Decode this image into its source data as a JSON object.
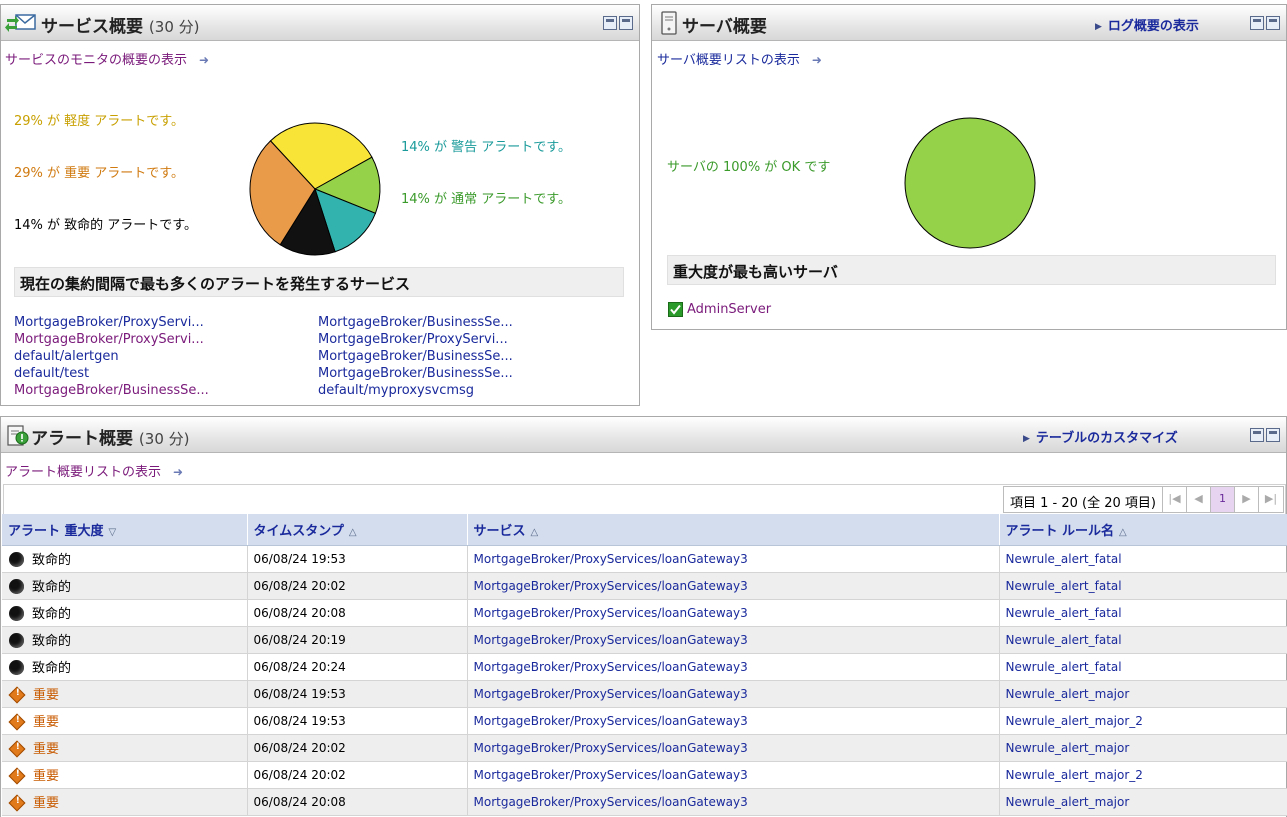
{
  "service_panel": {
    "title": "サービス概要",
    "period": "(30 分)",
    "monitor_link": "サービスのモニタの概要の表示",
    "arrow": "➜",
    "pie_labels": {
      "minor": "29% が 軽度 アラートです。",
      "major": "29% が 重要 アラートです。",
      "fatal": "14% が 致命的 アラートです。",
      "warning": "14% が 警告 アラートです。",
      "normal": "14% が 通常 アラートです。"
    },
    "top_section_title": "現在の集約間隔で最も多くのアラートを発生するサービス",
    "services_col1": [
      "MortgageBroker/ProxyServi...",
      "MortgageBroker/ProxyServi...",
      "default/alertgen",
      "default/test",
      "MortgageBroker/BusinessSe..."
    ],
    "services_col2": [
      "MortgageBroker/BusinessSe...",
      "MortgageBroker/ProxyServi...",
      "MortgageBroker/BusinessSe...",
      "MortgageBroker/BusinessSe...",
      "default/myproxysvcmsg"
    ]
  },
  "chart_data": {
    "type": "pie",
    "labels": [
      "軽度",
      "通常",
      "警告",
      "致命的",
      "重要"
    ],
    "values": [
      29,
      14,
      14,
      14,
      29
    ],
    "colors": [
      "#f7e436",
      "#96d14a",
      "#33b3ad",
      "#111111",
      "#e99b4a"
    ]
  },
  "server_panel": {
    "title": "サーバ概要",
    "log_link": "ログ概要の表示",
    "list_link": "サーバ概要リストの表示",
    "arrow": "➜",
    "status_label": "サーバの 100% が OK です",
    "pie_color": "#96d14a",
    "top_section_title": "重大度が最も高いサーバ",
    "server_name": "AdminServer"
  },
  "alert_panel": {
    "title": "アラート概要",
    "period": "(30 分)",
    "customize_link": "テーブルのカスタマイズ",
    "list_link": "アラート概要リストの表示",
    "arrow": "➜",
    "pager_text": "項目 1 - 20 (全 20 項目)",
    "current_page": "1",
    "columns": [
      "アラート 重大度",
      "タイムスタンプ",
      "サービス",
      "アラート ルール名"
    ],
    "sort_icons": [
      "▽",
      "△",
      "△",
      "△"
    ],
    "rows": [
      {
        "sev": "致命的",
        "kind": "fatal",
        "time": "06/08/24 19:53",
        "service": "MortgageBroker/ProxyServices/loanGateway3",
        "rule": "Newrule_alert_fatal"
      },
      {
        "sev": "致命的",
        "kind": "fatal",
        "time": "06/08/24 20:02",
        "service": "MortgageBroker/ProxyServices/loanGateway3",
        "rule": "Newrule_alert_fatal"
      },
      {
        "sev": "致命的",
        "kind": "fatal",
        "time": "06/08/24 20:08",
        "service": "MortgageBroker/ProxyServices/loanGateway3",
        "rule": "Newrule_alert_fatal"
      },
      {
        "sev": "致命的",
        "kind": "fatal",
        "time": "06/08/24 20:19",
        "service": "MortgageBroker/ProxyServices/loanGateway3",
        "rule": "Newrule_alert_fatal"
      },
      {
        "sev": "致命的",
        "kind": "fatal",
        "time": "06/08/24 20:24",
        "service": "MortgageBroker/ProxyServices/loanGateway3",
        "rule": "Newrule_alert_fatal"
      },
      {
        "sev": "重要",
        "kind": "major",
        "time": "06/08/24 19:53",
        "service": "MortgageBroker/ProxyServices/loanGateway3",
        "rule": "Newrule_alert_major"
      },
      {
        "sev": "重要",
        "kind": "major",
        "time": "06/08/24 19:53",
        "service": "MortgageBroker/ProxyServices/loanGateway3",
        "rule": "Newrule_alert_major_2"
      },
      {
        "sev": "重要",
        "kind": "major",
        "time": "06/08/24 20:02",
        "service": "MortgageBroker/ProxyServices/loanGateway3",
        "rule": "Newrule_alert_major"
      },
      {
        "sev": "重要",
        "kind": "major",
        "time": "06/08/24 20:02",
        "service": "MortgageBroker/ProxyServices/loanGateway3",
        "rule": "Newrule_alert_major_2"
      },
      {
        "sev": "重要",
        "kind": "major",
        "time": "06/08/24 20:08",
        "service": "MortgageBroker/ProxyServices/loanGateway3",
        "rule": "Newrule_alert_major"
      }
    ]
  }
}
